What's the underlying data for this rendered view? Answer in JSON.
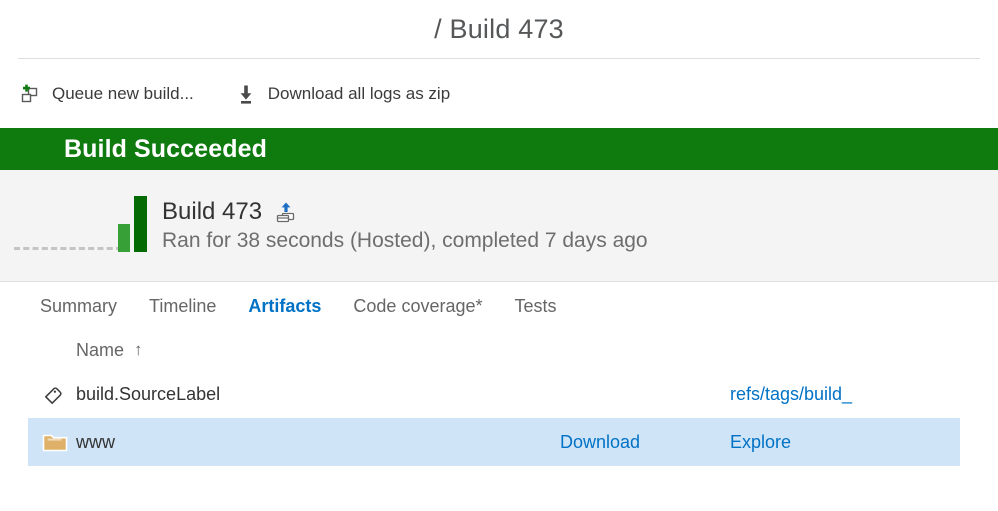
{
  "header": {
    "title": "/ Build 473"
  },
  "toolbar": {
    "commands": [
      {
        "label": "Queue new build...",
        "icon": "queue-new-build-icon"
      },
      {
        "label": "Download all logs as zip",
        "icon": "download-icon"
      }
    ]
  },
  "status": {
    "text": "Build Succeeded",
    "color": "#0f7b0f"
  },
  "summary": {
    "build_name": "Build 473",
    "detail": "Ran for 38 seconds (Hosted), completed 7 days ago",
    "release_icon": "release-deploy-icon",
    "sparkline": {
      "bars": [
        {
          "height": 28,
          "color": "#37a037"
        },
        {
          "height": 56,
          "color": "#046b04"
        }
      ]
    }
  },
  "tabs": [
    {
      "label": "Summary",
      "active": false
    },
    {
      "label": "Timeline",
      "active": false
    },
    {
      "label": "Artifacts",
      "active": true
    },
    {
      "label": "Code coverage*",
      "active": false
    },
    {
      "label": "Tests",
      "active": false
    }
  ],
  "artifacts": {
    "columns": {
      "name": "Name",
      "sort_indicator": "↑"
    },
    "rows": [
      {
        "icon": "tag-icon",
        "name": "build.SourceLabel",
        "action": "",
        "link": "refs/tags/build_",
        "selected": false
      },
      {
        "icon": "folder-icon",
        "name": "www",
        "action": "Download",
        "link": "Explore",
        "selected": true
      }
    ]
  },
  "colors": {
    "accent_link": "#0072c6",
    "success_green": "#0f7b0f",
    "selection_blue": "#cfe4f7",
    "folder_tan": "#dfb068"
  }
}
